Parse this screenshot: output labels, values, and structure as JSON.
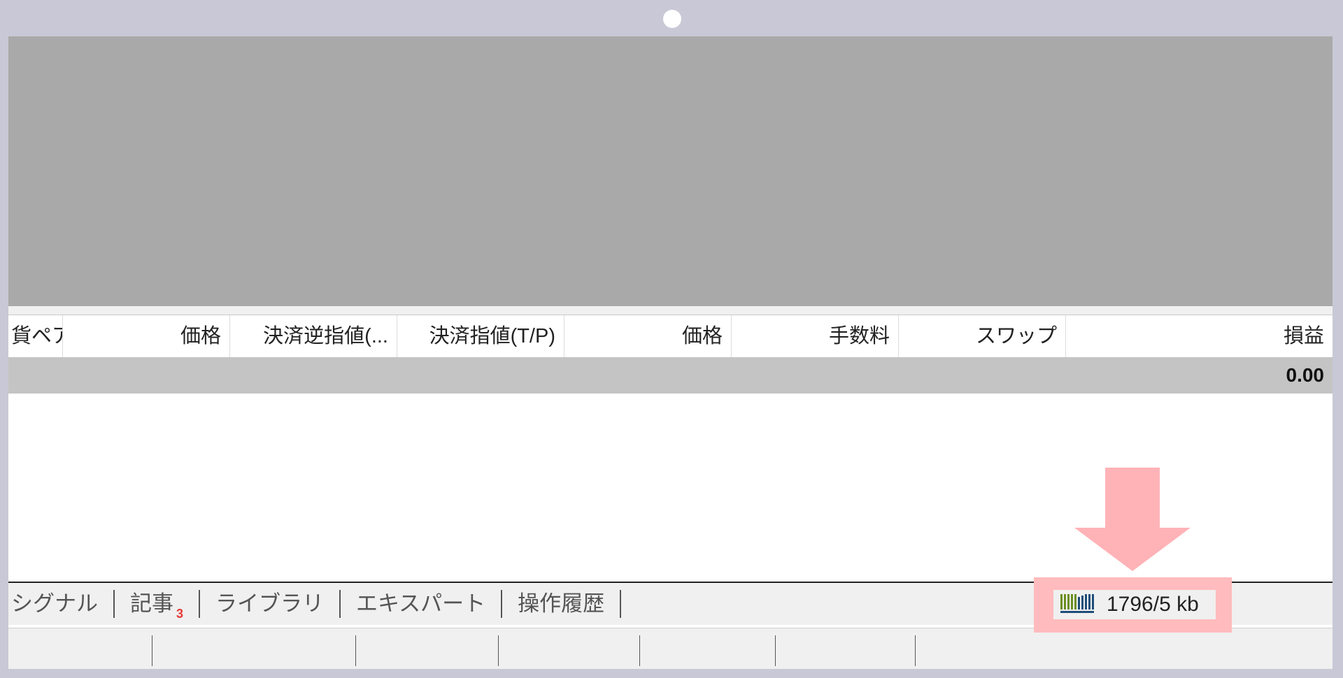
{
  "table": {
    "columns": [
      "貨ペア",
      "価格",
      "決済逆指値(...",
      "決済指値(T/P)",
      "価格",
      "手数料",
      "スワップ",
      "損益"
    ],
    "summary_value": "0.00"
  },
  "tabs": [
    {
      "label": "シグナル"
    },
    {
      "label": "記事",
      "badge": "3"
    },
    {
      "label": "ライブラリ"
    },
    {
      "label": "エキスパート"
    },
    {
      "label": "操作履歴"
    }
  ],
  "statusbar": {
    "traffic": "1796/5 kb",
    "traffic_icon": "connection-bars-icon"
  },
  "colors": {
    "highlight": "#ffbbbd",
    "arrow": "#ffb3b7",
    "badge": "#e53935",
    "traffic_green": "#6b8e23",
    "traffic_blue": "#1f4e79"
  }
}
